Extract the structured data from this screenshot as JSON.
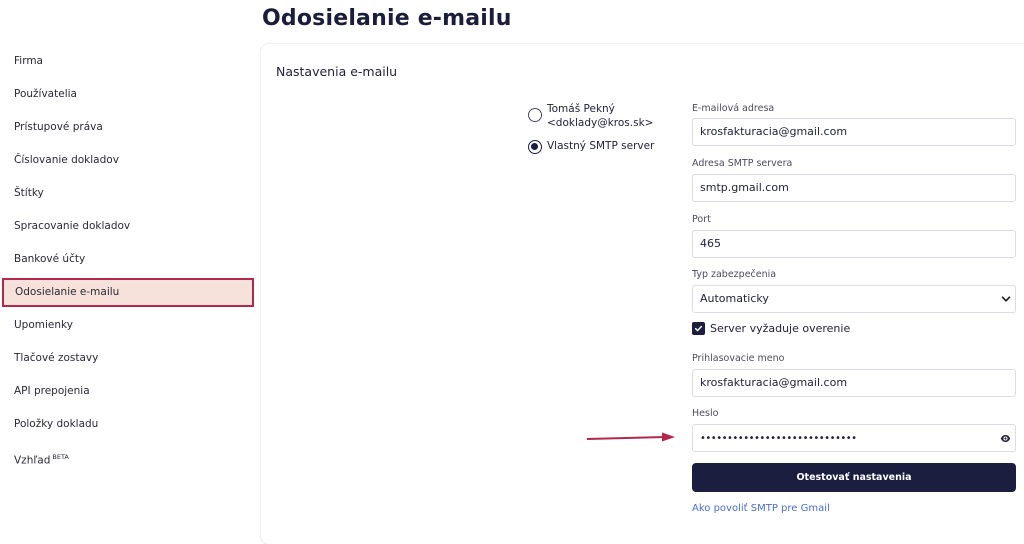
{
  "page_title": "Odosielanie e-mailu",
  "sidebar": {
    "items": [
      {
        "label": "Firma"
      },
      {
        "label": "Používatelia"
      },
      {
        "label": "Prístupové práva"
      },
      {
        "label": "Číslovanie dokladov"
      },
      {
        "label": "Štítky"
      },
      {
        "label": "Spracovanie dokladov"
      },
      {
        "label": "Bankové účty"
      },
      {
        "label": "Odosielanie e-mailu",
        "active": true
      },
      {
        "label": "Upomienky"
      },
      {
        "label": "Tlačové zostavy"
      },
      {
        "label": "API prepojenia"
      },
      {
        "label": "Položky dokladu"
      },
      {
        "label": "Vzhľad",
        "badge": "BETA"
      }
    ]
  },
  "card": {
    "title": "Nastavenia e-mailu"
  },
  "sender": {
    "option_default_line1": "Tomáš Pekný",
    "option_default_line2": "<doklady@kros.sk>",
    "option_smtp": "Vlastný SMTP server",
    "selected": "smtp"
  },
  "form": {
    "email_label": "E-mailová adresa",
    "email_value": "krosfakturacia@gmail.com",
    "smtp_label": "Adresa SMTP servera",
    "smtp_value": "smtp.gmail.com",
    "port_label": "Port",
    "port_value": "465",
    "security_label": "Typ zabezpečenia",
    "security_value": "Automaticky",
    "auth_checkbox_label": "Server vyžaduje overenie",
    "auth_checked": true,
    "login_label": "Prihlasovacie meno",
    "login_value": "krosfakturacia@gmail.com",
    "password_label": "Heslo",
    "password_value": "•••••••••••••••••••••••••••••"
  },
  "test_button_label": "Otestovať nastavenia",
  "help_link_label": "Ako povoliť SMTP pre Gmail",
  "colors": {
    "primary": "#1b1e3f",
    "highlight_bg": "#f6e2db",
    "highlight_border": "#b1284a",
    "arrow": "#b1284a",
    "link": "#4a6fc8"
  }
}
